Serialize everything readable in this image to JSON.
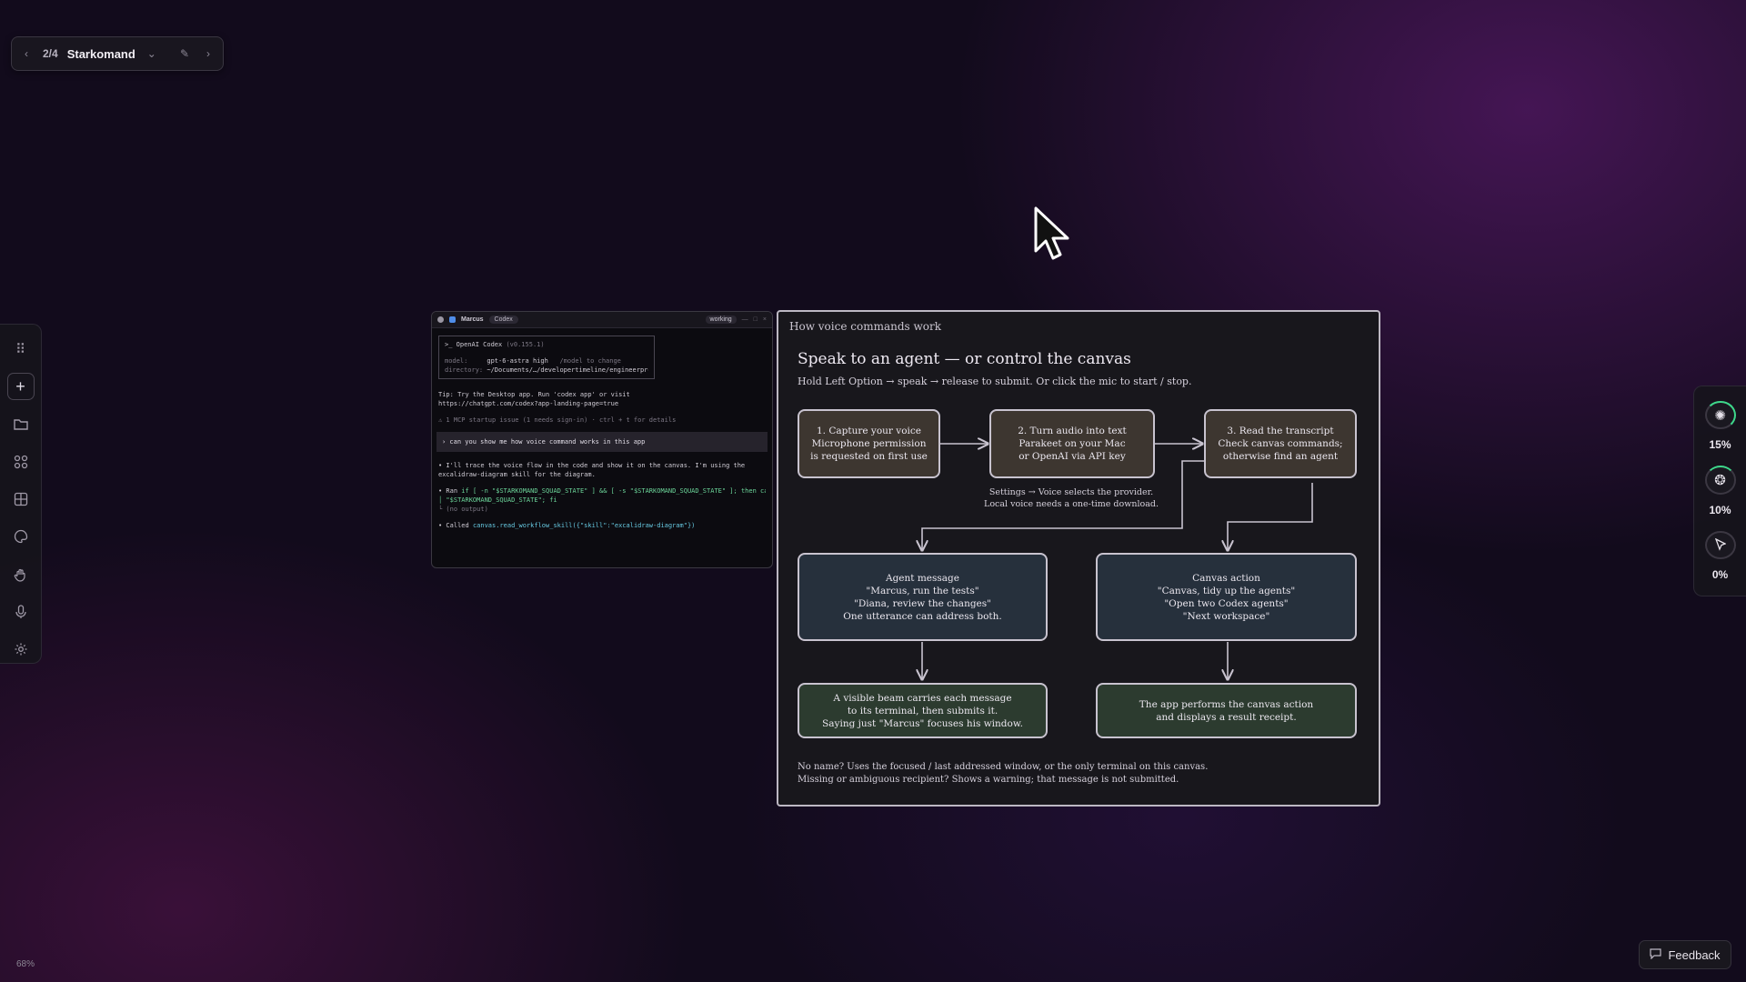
{
  "workspace": {
    "index": "2/4",
    "name": "Starkomand"
  },
  "rail": {
    "tools": [
      "grip-icon",
      "add-icon",
      "folder-icon",
      "apps-icon",
      "grid-icon",
      "palette-icon",
      "hand-icon",
      "mic-icon",
      "gear-icon"
    ]
  },
  "usage": {
    "items": [
      {
        "icon": "claude-icon",
        "percent": "15%"
      },
      {
        "icon": "openai-icon",
        "percent": "10%"
      },
      {
        "icon": "cursor-icon",
        "percent": "0%"
      }
    ]
  },
  "terminal": {
    "agent_name": "Marcus",
    "agent_type": "Codex",
    "status": "working",
    "header_line": ">_ OpenAI Codex",
    "version": "(v0.155.1)",
    "model_label": "model:",
    "model_value": "gpt-6-astra high",
    "model_hint": "/model to change",
    "dir_label": "directory:",
    "dir_value": "~/Documents/…/developertimeline/engineerpro",
    "tip_line1": "Tip: Try the Desktop app. Run 'codex app' or visit",
    "tip_line2": "https://chatgpt.com/codex?app-landing-page=true",
    "mcp_line": "⚠ 1 MCP startup issue (1 needs sign-in) · ctrl + t for details",
    "user_prompt": "› can you show me how voice command works in this app",
    "reply_line1": "• I'll trace the voice flow in the code and show it on the canvas. I'm using the",
    "reply_line2": "  excalidraw-diagram skill for the diagram.",
    "ran_prefix": "• Ran",
    "ran_cmd": "if [ -n \"$STARKOMAND_SQUAD_STATE\" ] && [ -s \"$STARKOMAND_SQUAD_STATE\" ]; then cat",
    "ran_cmd2": "  │ \"$STARKOMAND_SQUAD_STATE\"; fi",
    "ran_output": "  └ (no output)",
    "called_prefix": "• Called",
    "called_cmd": "canvas.read_workflow_skill({\"skill\":\"excalidraw-diagram\"})"
  },
  "diagram": {
    "label": "How voice commands work",
    "title": "Speak to an agent — or control the canvas",
    "subtitle": "Hold Left Option → speak → release to submit. Or click the mic to start / stop.",
    "step1": [
      "1. Capture your voice",
      "Microphone permission",
      "is requested on first use"
    ],
    "step2": [
      "2. Turn audio into text",
      "Parakeet on your Mac",
      "or OpenAI via API key"
    ],
    "step3": [
      "3. Read the transcript",
      "Check canvas commands;",
      "otherwise find an agent"
    ],
    "settings_note": [
      "Settings → Voice selects the provider.",
      "Local voice needs a one-time download."
    ],
    "agent_box": [
      "Agent message",
      "\"Marcus, run the tests\"",
      "\"Diana, review the changes\"",
      "One utterance can address both."
    ],
    "canvas_box": [
      "Canvas action",
      "\"Canvas, tidy up the agents\"",
      "\"Open two Codex agents\"",
      "\"Next workspace\""
    ],
    "beam_box": [
      "A visible beam carries each message",
      "to its terminal, then submits it.",
      "Saying just \"Marcus\" focuses his window."
    ],
    "result_box": [
      "The app performs the canvas action",
      "and displays a result receipt."
    ],
    "footer": [
      "No name? Uses the focused / last addressed window, or the only terminal on this canvas.",
      "Missing or ambiguous recipient? Shows a warning; that message is not submitted."
    ]
  },
  "zoom": "68%",
  "feedback": {
    "label": "Feedback"
  },
  "colors": {
    "accent_green": "#3ed88b",
    "panel": "#18171c",
    "background": "#120b1c"
  }
}
